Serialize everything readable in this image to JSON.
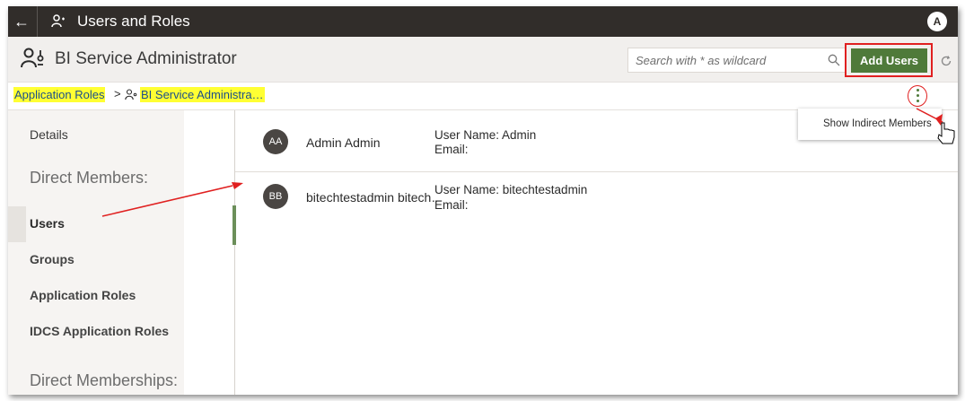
{
  "topbar": {
    "title": "Users and Roles",
    "user_initial": "A"
  },
  "header": {
    "title": "BI Service Administrator",
    "search_placeholder": "Search with * as wildcard",
    "add_users_label": "Add Users"
  },
  "breadcrumb": {
    "parent": "Application Roles",
    "separator": ">",
    "current": "BI Service Administra…"
  },
  "sidebar": {
    "details": "Details",
    "direct_members_heading": "Direct Members:",
    "items": [
      {
        "label": "Users"
      },
      {
        "label": "Groups"
      },
      {
        "label": "Application Roles"
      },
      {
        "label": "IDCS Application Roles"
      }
    ],
    "direct_memberships_heading": "Direct Memberships:"
  },
  "members": [
    {
      "initials": "AA",
      "name": "Admin Admin",
      "username": "User Name: Admin",
      "email": "Email:"
    },
    {
      "initials": "BB",
      "name": "bitechtestadmin bitech…",
      "username": "User Name: bitechtestadmin",
      "email": "Email:"
    }
  ],
  "menu": {
    "show_indirect": "Show Indirect Members"
  },
  "colors": {
    "topbar": "#312d2a",
    "accent_green": "#4f7a3a",
    "highlight": "#ffff33",
    "annotation_red": "#e02020"
  }
}
